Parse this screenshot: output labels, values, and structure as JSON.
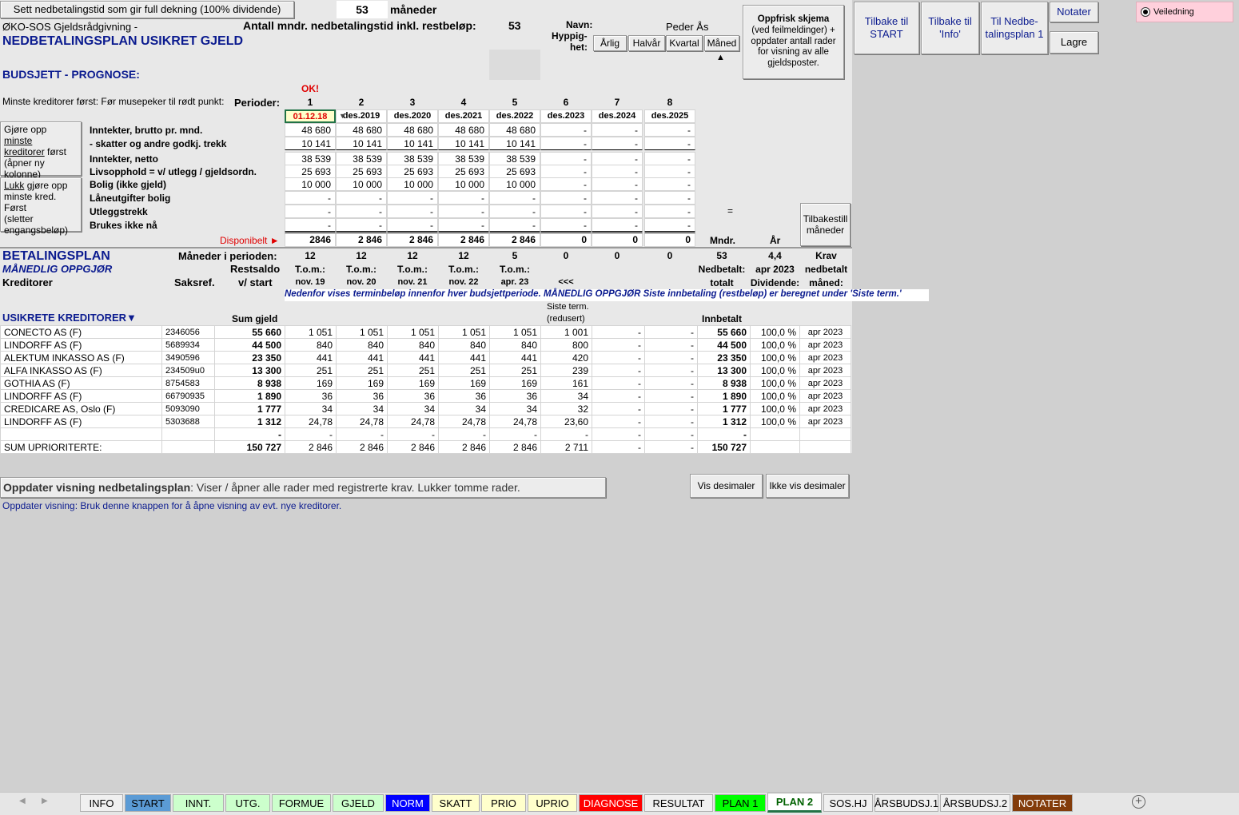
{
  "top": {
    "full_coverage_button": "Sett nedbetalingstid som gir full dekning (100% dividende)",
    "months_value": "53",
    "months_label": "måneder",
    "org": "ØKO-SOS Gjeldsrådgivning -",
    "title": "NEDBETALINGSPLAN USIKRET GJELD",
    "total_months_label": "Antall mndr. nedbetalingstid inkl. restbeløp:",
    "total_months_value": "53",
    "name_label": "Navn:",
    "name_value": "Peder Ås",
    "freq_label_1": "Hyppig-",
    "freq_label_2": "het:",
    "freq_buttons": [
      "Årlig",
      "Halvår",
      "Kvartal",
      "Måned"
    ],
    "freq_marker": "▲",
    "refresh_button": [
      "Oppfrisk skjema",
      "(ved feilmeldinger) +",
      "oppdater antall rader",
      "for visning av alle",
      "gjeldsposter."
    ],
    "nav_buttons": [
      "Tilbake til START",
      "Tilbake til 'Info'",
      "Til Nedbe-talingsplan 1"
    ],
    "notes_button": "Notater",
    "save_button": "Lagre",
    "guide_radio": "Veiledning"
  },
  "budget": {
    "heading": "BUDSJETT - PROGNOSE:",
    "ok": "OK!",
    "hint": "Minste kreditorer først: Før musepeker til rødt punkt:",
    "periods_label": "Perioder:",
    "periods": [
      "1",
      "2",
      "3",
      "4",
      "5",
      "6",
      "7",
      "8"
    ],
    "dates": [
      "01.12.18",
      "des.2019",
      "des.2020",
      "des.2021",
      "des.2022",
      "des.2023",
      "des.2024",
      "des.2025"
    ],
    "btn_min_first": [
      "Gjøre opp ",
      "minste",
      "kreditorer",
      " først",
      "(åpner ny",
      "kolonne)"
    ],
    "btn_close": [
      "Lukk",
      " gjøre opp",
      "minste kred. Først",
      "(sletter",
      "engangsbeløp)"
    ],
    "rows": [
      {
        "label": "Inntekter, brutto pr. mnd.",
        "values": [
          "48 680",
          "48 680",
          "48 680",
          "48 680",
          "48 680",
          "-",
          "-",
          "-"
        ]
      },
      {
        "label": " - skatter og andre godkj. trekk",
        "values": [
          "10 141",
          "10 141",
          "10 141",
          "10 141",
          "10 141",
          "-",
          "-",
          "-"
        ]
      },
      {
        "label": "Inntekter, netto",
        "values": [
          "38 539",
          "38 539",
          "38 539",
          "38 539",
          "38 539",
          "-",
          "-",
          "-"
        ]
      },
      {
        "label": "Livsopphold = v/ utlegg / gjeldsordn.",
        "values": [
          "25 693",
          "25 693",
          "25 693",
          "25 693",
          "25 693",
          "-",
          "-",
          "-"
        ]
      },
      {
        "label": "Bolig (ikke gjeld)",
        "values": [
          "10 000",
          "10 000",
          "10 000",
          "10 000",
          "10 000",
          "-",
          "-",
          "-"
        ]
      },
      {
        "label": "Låneutgifter bolig",
        "values": [
          "-",
          "-",
          "-",
          "-",
          "-",
          "-",
          "-",
          "-"
        ]
      },
      {
        "label": "Utleggstrekk",
        "values": [
          "-",
          "-",
          "-",
          "-",
          "-",
          "-",
          "-",
          "-"
        ]
      },
      {
        "label": "Brukes ikke nå",
        "values": [
          "-",
          "-",
          "-",
          "-",
          "-",
          "-",
          "-",
          "-"
        ]
      }
    ],
    "equals": "=",
    "disponibelt_label": "Disponibelt ►",
    "disponibelt": [
      "2846",
      "2 846",
      "2 846",
      "2 846",
      "2 846",
      "0",
      "0",
      "0"
    ],
    "mndr_label": "Mndr.",
    "ar_label": "År",
    "reset_button": [
      "Tilbakestill",
      "måneder"
    ]
  },
  "plan": {
    "heading": "BETALINGSPLAN",
    "subheading": "MÅNEDLIG OPPGJØR",
    "kreditorer": "Kreditorer",
    "saksref": "Saksref.",
    "months_label": "Måneder i perioden:",
    "restsaldo_1": "Restsaldo",
    "restsaldo_2": "v/ start",
    "months": [
      "12",
      "12",
      "12",
      "12",
      "5",
      "0",
      "0",
      "0"
    ],
    "tom": [
      "T.o.m.:",
      "T.o.m.:",
      "T.o.m.:",
      "T.o.m.:",
      "T.o.m.:",
      "",
      "",
      ""
    ],
    "tom_dates": [
      "nov. 19",
      "nov. 20",
      "nov. 21",
      "nov. 22",
      "apr. 23",
      "<<<",
      "",
      ""
    ],
    "summary_values": [
      "53",
      "4,4",
      "Krav"
    ],
    "summary_row2": [
      "Nedbetalt:",
      "apr 2023",
      "nedbetalt"
    ],
    "summary_row3": [
      "totalt",
      "Dividende:",
      "måned:"
    ],
    "info_line": "Nedenfor vises terminbeløp innenfor hver budsjettperiode. MÅNEDLIG OPPGJØR Siste innbetaling (restbeløp) er beregnet under 'Siste term.'",
    "usikrete": "USIKRETE KREDITORER▼",
    "sum_gjeld": "Sum gjeld",
    "siste_term_1": "Siste term.",
    "siste_term_2": "(redusert)",
    "innbetalt": "Innbetalt",
    "creditors": [
      {
        "name": "CONECTO AS (F)",
        "ref": "2346056",
        "sum": "55 660",
        "p": [
          "1 051",
          "1 051",
          "1 051",
          "1 051",
          "1 051",
          "1 001",
          "-",
          "-"
        ],
        "paid": "55 660",
        "div": "100,0 %",
        "month": "apr 2023"
      },
      {
        "name": "LINDORFF AS (F)",
        "ref": "5689934",
        "sum": "44 500",
        "p": [
          "840",
          "840",
          "840",
          "840",
          "840",
          "800",
          "-",
          "-"
        ],
        "paid": "44 500",
        "div": "100,0 %",
        "month": "apr 2023"
      },
      {
        "name": "ALEKTUM INKASSO AS (F)",
        "ref": "3490596",
        "sum": "23 350",
        "p": [
          "441",
          "441",
          "441",
          "441",
          "441",
          "420",
          "-",
          "-"
        ],
        "paid": "23 350",
        "div": "100,0 %",
        "month": "apr 2023"
      },
      {
        "name": "ALFA INKASSO AS (F)",
        "ref": "234509u0",
        "sum": "13 300",
        "p": [
          "251",
          "251",
          "251",
          "251",
          "251",
          "239",
          "-",
          "-"
        ],
        "paid": "13 300",
        "div": "100,0 %",
        "month": "apr 2023"
      },
      {
        "name": "GOTHIA AS (F)",
        "ref": "8754583",
        "sum": "8 938",
        "p": [
          "169",
          "169",
          "169",
          "169",
          "169",
          "161",
          "-",
          "-"
        ],
        "paid": "8 938",
        "div": "100,0 %",
        "month": "apr 2023"
      },
      {
        "name": "LINDORFF AS (F)",
        "ref": "66790935",
        "sum": "1 890",
        "p": [
          "36",
          "36",
          "36",
          "36",
          "36",
          "34",
          "-",
          "-"
        ],
        "paid": "1 890",
        "div": "100,0 %",
        "month": "apr 2023"
      },
      {
        "name": "CREDICARE AS, Oslo (F)",
        "ref": "5093090",
        "sum": "1 777",
        "p": [
          "34",
          "34",
          "34",
          "34",
          "34",
          "32",
          "-",
          "-"
        ],
        "paid": "1 777",
        "div": "100,0 %",
        "month": "apr 2023"
      },
      {
        "name": "LINDORFF AS (F)",
        "ref": "5303688",
        "sum": "1 312",
        "p": [
          "24,78",
          "24,78",
          "24,78",
          "24,78",
          "24,78",
          "23,60",
          "-",
          "-"
        ],
        "paid": "1 312",
        "div": "100,0 %",
        "month": "apr 2023"
      },
      {
        "name": "",
        "ref": "",
        "sum": "-",
        "p": [
          "-",
          "-",
          "-",
          "-",
          "-",
          "-",
          "-",
          "-"
        ],
        "paid": "-",
        "div": "",
        "month": ""
      }
    ],
    "sum_row": {
      "name": "SUM UPRIORITERTE:",
      "sum": "150 727",
      "p": [
        "2 846",
        "2 846",
        "2 846",
        "2 846",
        "2 846",
        "2 711",
        "-",
        "-"
      ],
      "paid": "150 727"
    }
  },
  "bottom": {
    "update_button_bold": "Oppdater visning nedbetalingsplan",
    "update_button_rest": ": Viser / åpner  alle rader med registrerte krav. Lukker tomme rader.",
    "show_decimals": "Vis desimaler",
    "hide_decimals": "Ikke vis desimaler",
    "note": "Oppdater visning: Bruk denne knappen for å åpne visning av evt. nye kreditorer."
  },
  "tabs": [
    {
      "label": "INFO",
      "bg": "#f0f0f0",
      "fg": "#000000"
    },
    {
      "label": "START",
      "bg": "#5b9bd5",
      "fg": "#000000"
    },
    {
      "label": "INNT.",
      "bg": "#ccffcc",
      "fg": "#000000"
    },
    {
      "label": "UTG.",
      "bg": "#ccffcc",
      "fg": "#000000"
    },
    {
      "label": "FORMUE",
      "bg": "#ccffcc",
      "fg": "#000000"
    },
    {
      "label": "GJELD",
      "bg": "#ccffcc",
      "fg": "#000000"
    },
    {
      "label": "NORM",
      "bg": "#0000ff",
      "fg": "#ffffff"
    },
    {
      "label": "SKATT",
      "bg": "#ffffcc",
      "fg": "#000000"
    },
    {
      "label": "PRIO",
      "bg": "#ffffcc",
      "fg": "#000000"
    },
    {
      "label": "UPRIO",
      "bg": "#ffffcc",
      "fg": "#000000"
    },
    {
      "label": "DIAGNOSE",
      "bg": "#ff0000",
      "fg": "#ffffff"
    },
    {
      "label": "RESULTAT",
      "bg": "#f0f0f0",
      "fg": "#000000"
    },
    {
      "label": "PLAN 1",
      "bg": "#00ff00",
      "fg": "#000000"
    },
    {
      "label": "PLAN 2",
      "bg": "#ffffff",
      "fg": "#006100"
    },
    {
      "label": "SOS.HJ",
      "bg": "#f0f0f0",
      "fg": "#000000"
    },
    {
      "label": "ÅRSBUDSJ.1",
      "bg": "#f0f0f0",
      "fg": "#000000"
    },
    {
      "label": "ÅRSBUDSJ.2",
      "bg": "#f0f0f0",
      "fg": "#000000"
    },
    {
      "label": "NOTATER",
      "bg": "#833c0b",
      "fg": "#ffffff"
    }
  ],
  "icons": {
    "add_sheet": "plus-circle-icon",
    "scroll_left": "triangle-left-icon",
    "scroll_right": "triangle-right-icon"
  }
}
